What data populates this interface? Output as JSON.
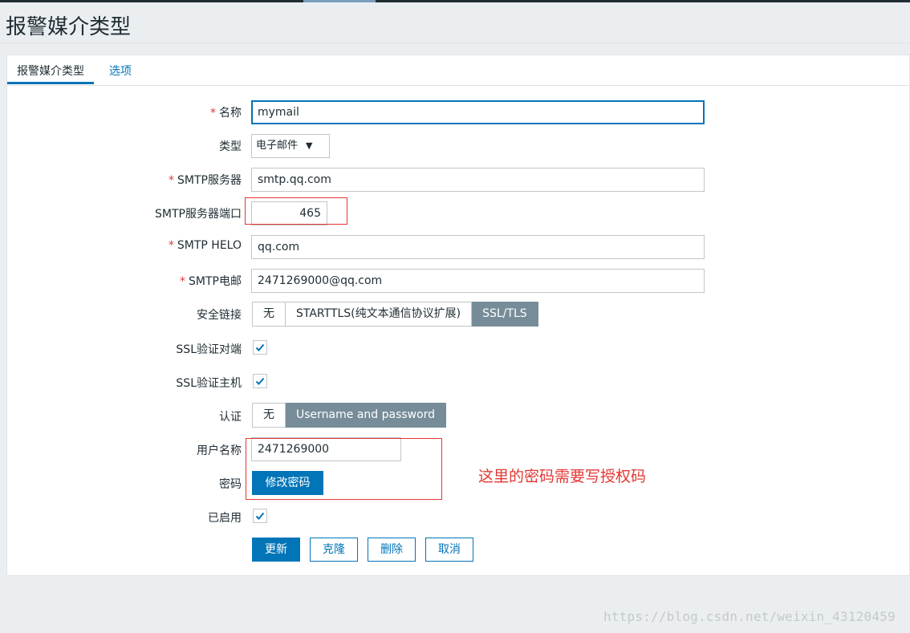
{
  "page": {
    "title": "报警媒介类型"
  },
  "tabs": [
    {
      "label": "报警媒介类型",
      "active": true
    },
    {
      "label": "选项",
      "active": false
    }
  ],
  "form": {
    "name": {
      "label": "名称",
      "required": true,
      "value": "mymail"
    },
    "type": {
      "label": "类型",
      "value": "电子邮件"
    },
    "smtp_server": {
      "label": "SMTP服务器",
      "required": true,
      "value": "smtp.qq.com"
    },
    "smtp_port": {
      "label": "SMTP服务器端口",
      "value": "465"
    },
    "smtp_helo": {
      "label": "SMTP HELO",
      "required": true,
      "value": "qq.com"
    },
    "smtp_email": {
      "label": "SMTP电邮",
      "required": true,
      "value": "2471269000@qq.com"
    },
    "security": {
      "label": "安全链接",
      "options": [
        "无",
        "STARTTLS(纯文本通信协议扩展)",
        "SSL/TLS"
      ],
      "selected": "SSL/TLS"
    },
    "ssl_verify_peer": {
      "label": "SSL验证对端",
      "checked": true
    },
    "ssl_verify_host": {
      "label": "SSL验证主机",
      "checked": true
    },
    "auth": {
      "label": "认证",
      "options": [
        "无",
        "Username and password"
      ],
      "selected": "Username and password"
    },
    "username": {
      "label": "用户名称",
      "value": "2471269000"
    },
    "password": {
      "label": "密码",
      "button": "修改密码"
    },
    "enabled": {
      "label": "已启用",
      "checked": true
    }
  },
  "actions": {
    "update": "更新",
    "clone": "克隆",
    "delete": "删除",
    "cancel": "取消"
  },
  "annotation": {
    "note": "这里的密码需要写授权码"
  },
  "watermark": "https://blog.csdn.net/weixin_43120459",
  "colors": {
    "accent": "#0275b8",
    "segment_selected": "#768d99",
    "annotation": "#e33734",
    "required": "#e33734"
  }
}
